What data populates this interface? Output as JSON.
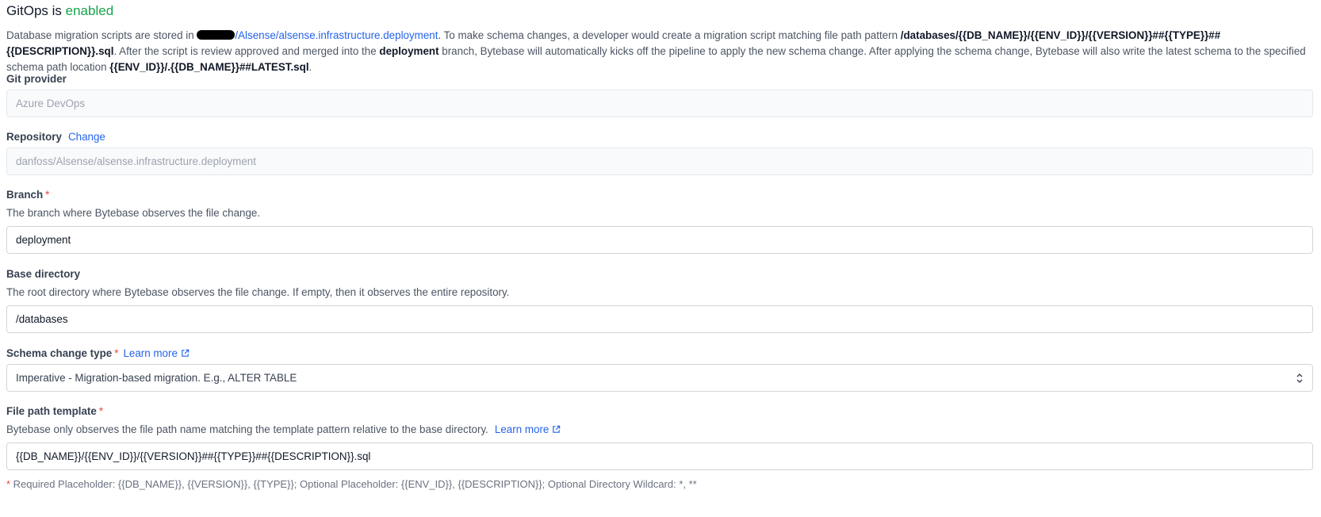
{
  "header": {
    "title_prefix": "GitOps is",
    "title_status": "enabled"
  },
  "intro": {
    "p1": "Database migration scripts are stored in ",
    "repo_path_suffix": "/Alsense/alsense.infrastructure.deployment",
    "p2": ". To make schema changes, a developer would create a migration script matching file path pattern ",
    "pattern_bold": "/databases/{{DB_NAME}}/{{ENV_ID}}/{{VERSION}}##{{TYPE}}##{{DESCRIPTION}}.sql",
    "p3": ". After the script is review approved and merged into the ",
    "branch_bold": "deployment",
    "p4": " branch, Bytebase will automatically kicks off the pipeline to apply the new schema change. After applying the schema change, Bytebase will also write the latest schema to the specified schema path location ",
    "latest_bold": "{{ENV_ID}}/.{{DB_NAME}}##LATEST.sql",
    "p5": "."
  },
  "git_provider": {
    "label": "Git provider",
    "value": "Azure DevOps"
  },
  "repository": {
    "label": "Repository",
    "change_link": "Change",
    "value": "danfoss/Alsense/alsense.infrastructure.deployment"
  },
  "branch": {
    "label": "Branch",
    "required": "*",
    "help": "The branch where Bytebase observes the file change.",
    "value": "deployment"
  },
  "base_directory": {
    "label": "Base directory",
    "help": "The root directory where Bytebase observes the file change. If empty, then it observes the entire repository.",
    "value": "/databases"
  },
  "schema_change_type": {
    "label": "Schema change type",
    "required": "*",
    "learn_more": "Learn more",
    "selected": "Imperative - Migration-based migration. E.g., ALTER TABLE"
  },
  "file_path_template": {
    "label": "File path template",
    "required": "*",
    "help": "Bytebase only observes the file path name matching the template pattern relative to the base directory.",
    "learn_more": "Learn more",
    "value": "{{DB_NAME}}/{{ENV_ID}}/{{VERSION}}##{{TYPE}}##{{DESCRIPTION}}.sql"
  },
  "footnote": {
    "star": "*",
    "text": " Required Placeholder: {{DB_NAME}}, {{VERSION}}, {{TYPE}}; Optional Placeholder: {{ENV_ID}}, {{DESCRIPTION}}; Optional Directory Wildcard: *, **"
  },
  "colors": {
    "enabled": "#16a34a",
    "link": "#2563eb",
    "required": "#ef4444"
  }
}
